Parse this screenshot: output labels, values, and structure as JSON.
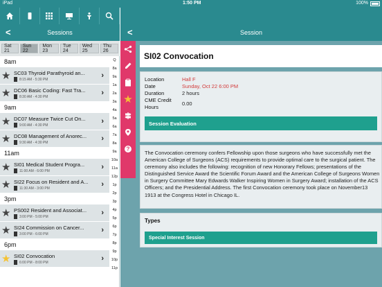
{
  "status": {
    "carrier": "iPad",
    "time": "1:50 PM",
    "battery": "100%"
  },
  "left": {
    "toolbar_icons": [
      "home-icon",
      "phone-icon",
      "grid-icon",
      "presentation-icon",
      "lectern-icon",
      "search-icon"
    ],
    "header_title": "Sessions",
    "back_label": "<",
    "days": [
      {
        "label": "Sat 21",
        "active": false
      },
      {
        "label": "Sun 22",
        "active": true
      },
      {
        "label": "Mon 23",
        "active": false
      },
      {
        "label": "Tue 24",
        "active": false
      },
      {
        "label": "Wed 25",
        "active": false
      },
      {
        "label": "Thu 26",
        "active": false
      }
    ],
    "groups": [
      {
        "hour": "8am",
        "items": [
          {
            "title": "SC03 Thyroid Parathyroid an...",
            "time": "8:15 AM - 5:30 PM",
            "fav": false
          },
          {
            "title": "DC06 Basic Coding: Fast Tra...",
            "time": "8:30 AM - 4:30 PM",
            "fav": false
          }
        ]
      },
      {
        "hour": "9am",
        "items": [
          {
            "title": "DC07 Measure Twice Cut On...",
            "time": "9:00 AM - 4:30 PM",
            "fav": false
          },
          {
            "title": "DC08 Management of Anorec...",
            "time": "9:30 AM - 4:30 PM",
            "fav": false
          }
        ]
      },
      {
        "hour": "11am",
        "items": [
          {
            "title": "SI01 Medical Student Progra...",
            "time": "11:00 AM - 6:00 PM",
            "fav": false
          },
          {
            "title": "SI22 Focus on Resident and A...",
            "time": "11:30 AM - 3:00 PM",
            "fav": false
          }
        ]
      },
      {
        "hour": "3pm",
        "items": [
          {
            "title": "PS002 Resident and Associat...",
            "time": "3:00 PM - 5:00 PM",
            "fav": false
          },
          {
            "title": "SI24 Commission on Cancer...",
            "time": "3:00 PM - 6:00 PM",
            "fav": false
          }
        ]
      },
      {
        "hour": "6pm",
        "items": [
          {
            "title": "SI02 Convocation",
            "time": "6:00 PM - 8:00 PM",
            "fav": true
          }
        ]
      }
    ],
    "index": [
      "Q",
      "8a",
      "9a",
      "1a",
      "2a",
      "3a",
      "4a",
      "5a",
      "6a",
      "7a",
      "8a",
      "9a",
      "10a",
      "11a",
      "12p",
      "1p",
      "2p",
      "3p",
      "4p",
      "5p",
      "6p",
      "7p",
      "8p",
      "9p",
      "10p",
      "11p"
    ]
  },
  "right": {
    "header_title": "Session",
    "back_label": "<",
    "action_icons": [
      "share-icon",
      "pencil-icon",
      "clipboard-icon",
      "star-icon",
      "signpost-icon",
      "location-pin-icon",
      "help-icon"
    ],
    "session_title": "SI02 Convocation",
    "info": {
      "location_label": "Location",
      "location": "Hall F",
      "date_label": "Date",
      "date": "Sunday, Oct 22 6:00 PM",
      "duration_label": "Duration",
      "duration": "2 hours",
      "cme_label_1": "CME Credit",
      "cme_label_2": "Hours",
      "cme": "0.00"
    },
    "evaluation_button": "Session Evaluation",
    "description": "The Convocation ceremony confers Fellowship upon those surgeons who have successfully met the American College of Surgeons (ACS) requirements to provide optimal care to the surgical patient. The ceremony also includes the following: recognition of new Honorary Fellows; presentations of the Distinguished Service Award the Scientific Forum Award and the American College of Surgeons Women in Surgery Committee Mary Edwards Walker Inspiring Women in Surgery Award; installation of the ACS Officers; and the Presidential Address. The first Convocation ceremony took place on November13 1913 at the Congress Hotel in Chicago IL.",
    "types_label": "Types",
    "types": [
      "Special Interest Session"
    ]
  },
  "colors": {
    "teal": "#2a8a8f",
    "accent_green": "#1fa08e",
    "pink": "#e0386a",
    "red_text": "#d23a3a",
    "star_yellow": "#f5c233"
  }
}
